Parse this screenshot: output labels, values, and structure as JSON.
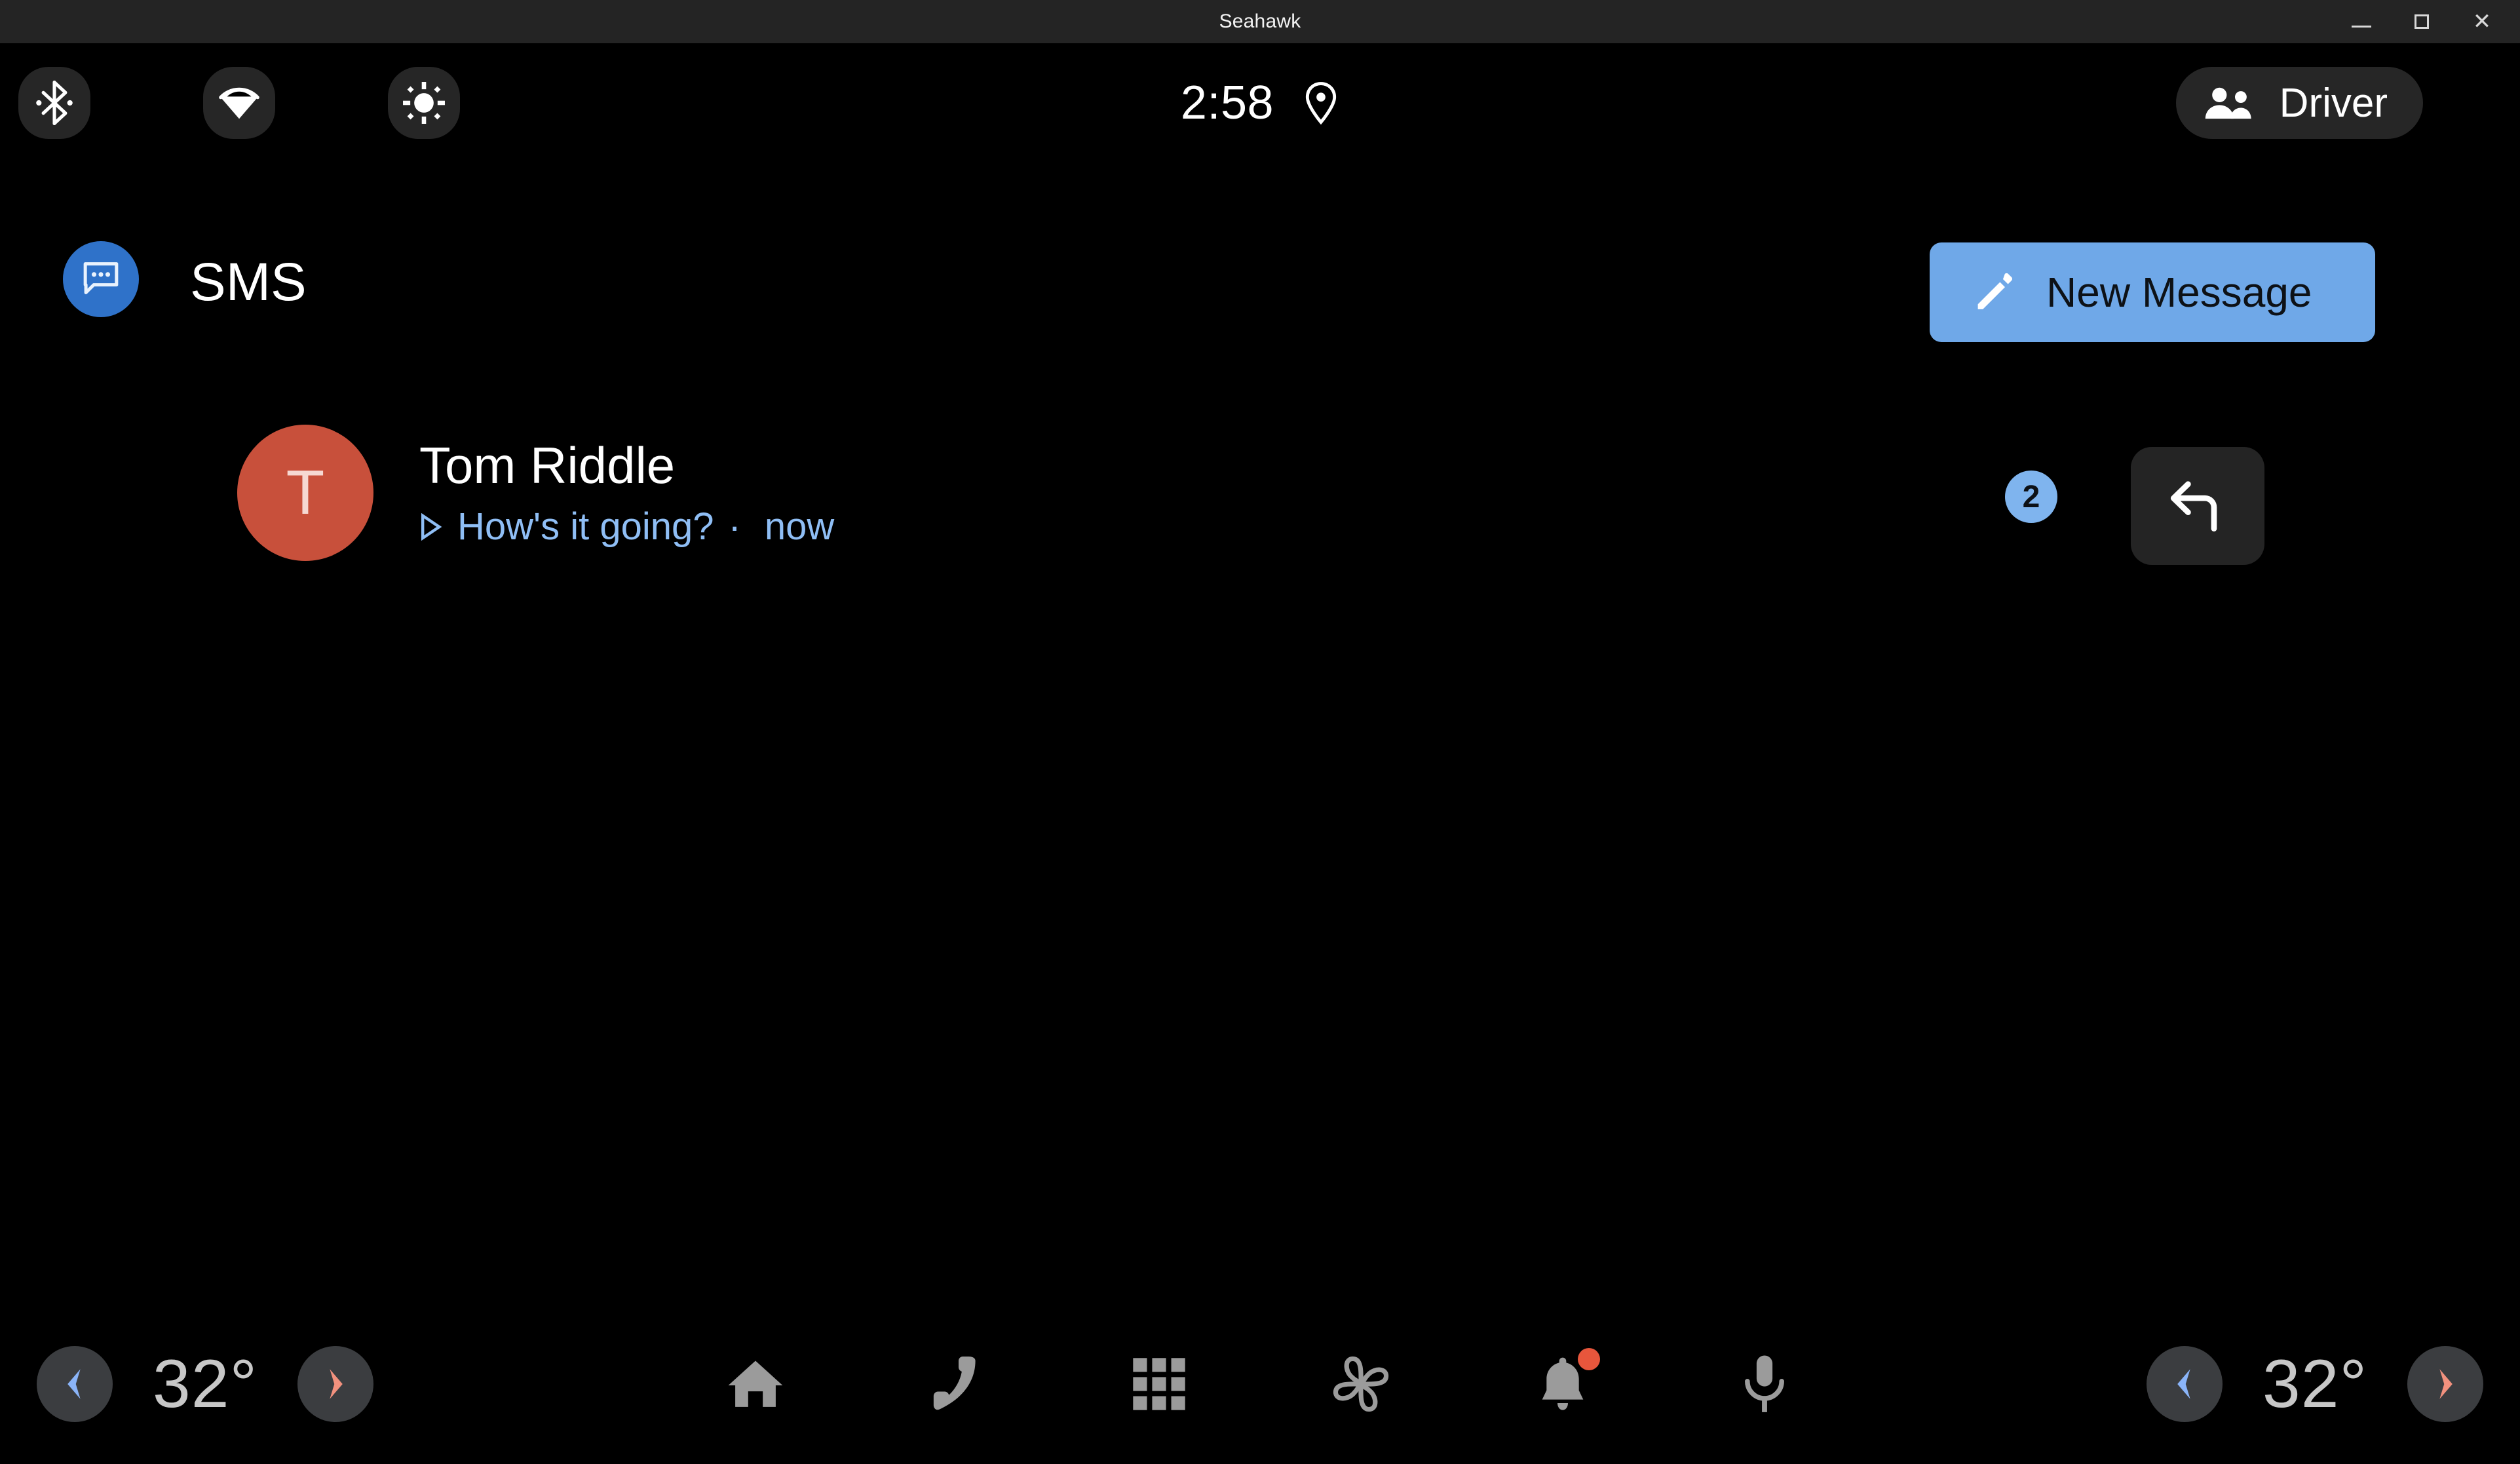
{
  "window": {
    "title": "Seahawk",
    "minimize_label": "–",
    "maximize_label": "□",
    "close_label": "✕"
  },
  "status_bar": {
    "quick_toggles": [
      {
        "name": "bluetooth-icon",
        "label": "Bluetooth"
      },
      {
        "name": "wifi-icon",
        "label": "Wi-Fi"
      },
      {
        "name": "brightness-icon",
        "label": "Brightness"
      }
    ],
    "clock": "2:58",
    "location_icon": "location-pin-icon",
    "profile": {
      "label": "Driver",
      "icon": "people-icon"
    }
  },
  "app_header": {
    "app_icon": "sms-chat-bubble-icon",
    "title": "SMS",
    "new_message": {
      "label": "New Message",
      "icon": "pencil-icon",
      "accent_color": "#6FA8E8"
    }
  },
  "conversations": [
    {
      "avatar_letter": "T",
      "avatar_color": "#C8503B",
      "name": "Tom Riddle",
      "play_icon": "play-triangle-icon",
      "preview": "How's it going?",
      "separator": "·",
      "timestamp": "now",
      "unread_count": "2",
      "reply_icon": "reply-arrow-icon",
      "preview_color": "#8FBEF5"
    }
  ],
  "nav_bar": {
    "left_temp": {
      "decrease_icon": "chevron-left-icon",
      "value": "32°",
      "increase_icon": "chevron-right-icon"
    },
    "right_temp": {
      "decrease_icon": "chevron-left-icon",
      "value": "32°",
      "increase_icon": "chevron-right-icon"
    },
    "items": [
      {
        "name": "home-icon",
        "label": "Home"
      },
      {
        "name": "phone-icon",
        "label": "Phone"
      },
      {
        "name": "apps-grid-icon",
        "label": "Apps"
      },
      {
        "name": "fan-climate-icon",
        "label": "Climate"
      },
      {
        "name": "bell-notifications-icon",
        "label": "Notifications",
        "has_badge": true
      },
      {
        "name": "microphone-icon",
        "label": "Assistant"
      }
    ],
    "badge_color": "#E8563C"
  }
}
